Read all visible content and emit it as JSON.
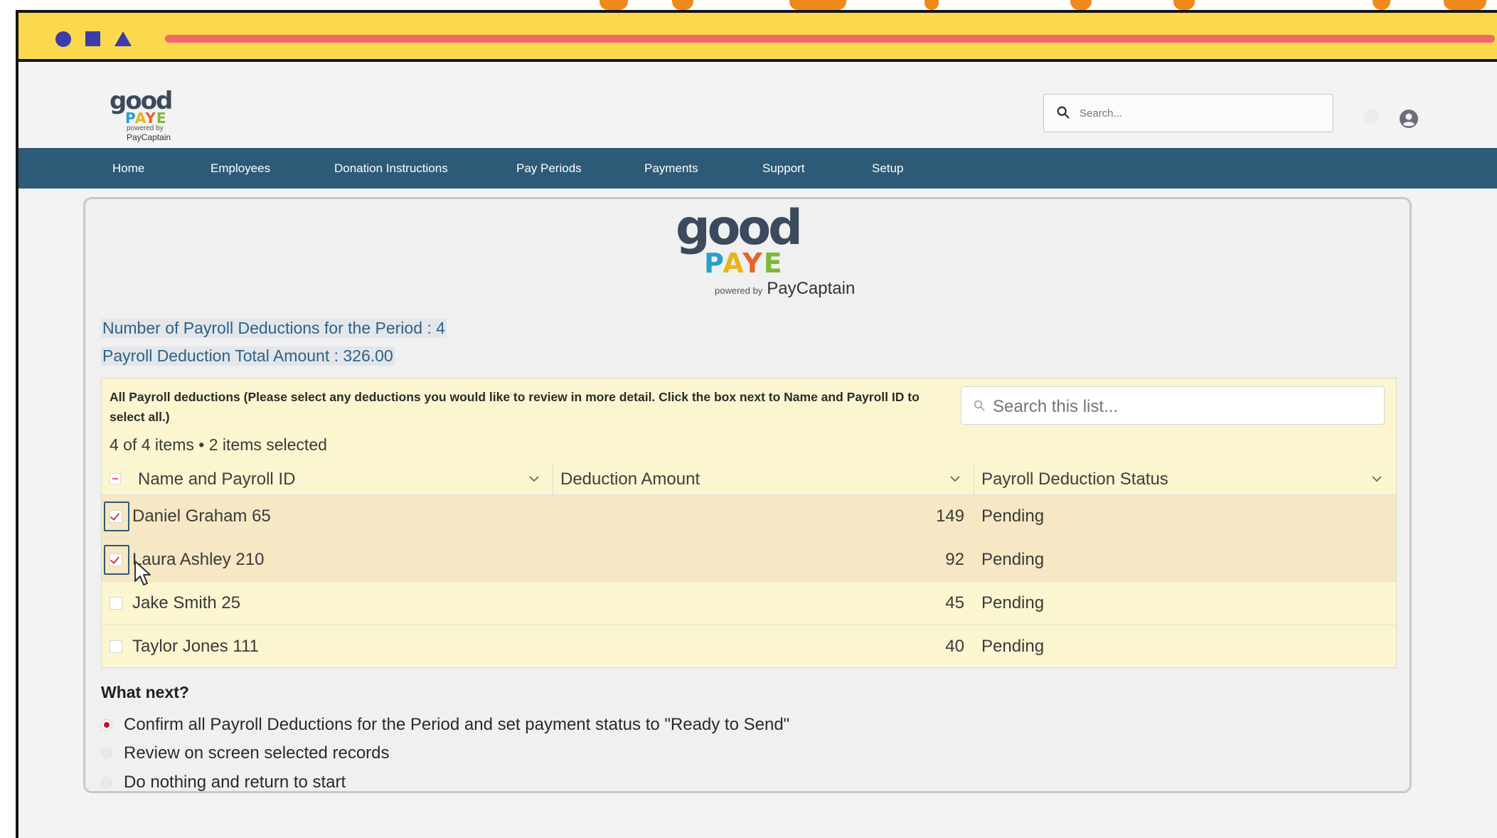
{
  "brand": {
    "logo_word": "good",
    "logo_sub": "PAYE",
    "powered_by": "powered by",
    "partner": "PayCaptain",
    "colors": {
      "navy": "#3b4a5c",
      "nav_bar": "#2d5a76",
      "titlebar": "#fbd84d",
      "progress": "#ef6b6b",
      "accent_red": "#c8102e"
    }
  },
  "header": {
    "search_placeholder": "Search...",
    "avatar_icon": "user-circle-icon"
  },
  "nav": {
    "items": [
      "Home",
      "Employees",
      "Donation Instructions",
      "Pay Periods",
      "Payments",
      "Support",
      "Setup"
    ]
  },
  "summary": {
    "count_line": "Number of Payroll Deductions for the Period : 4",
    "total_line": "Payroll Deduction Total Amount : 326.00"
  },
  "list": {
    "description": "All Payroll deductions (Please select any deductions you would like to review in more detail. Click the box next to Name and Payroll ID to select all.)",
    "search_placeholder": "Search this list...",
    "item_count": "4 of 4 items • 2 items selected",
    "columns": [
      "Name and Payroll ID",
      "Deduction Amount",
      "Payroll Deduction Status"
    ],
    "rows": [
      {
        "name": "Daniel Graham 65",
        "amount": "149",
        "status": "Pending",
        "selected": true
      },
      {
        "name": "Laura Ashley 210",
        "amount": "92",
        "status": "Pending",
        "selected": true
      },
      {
        "name": "Jake Smith 25",
        "amount": "45",
        "status": "Pending",
        "selected": false
      },
      {
        "name": "Taylor Jones 111",
        "amount": "40",
        "status": "Pending",
        "selected": false
      }
    ]
  },
  "what_next": {
    "title": "What next?",
    "options": [
      {
        "label": "Confirm all Payroll Deductions for the Period and set payment status to \"Ready to Send\"",
        "checked": true
      },
      {
        "label": "Review on screen selected records",
        "checked": false
      },
      {
        "label": "Do nothing and return to start",
        "checked": false
      }
    ]
  }
}
